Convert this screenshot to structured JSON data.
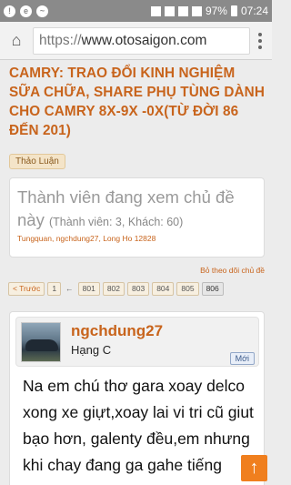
{
  "statusbar": {
    "battery": "97%",
    "time": "07:24"
  },
  "browser": {
    "scheme": "https://",
    "host": "www.otosaigon.com"
  },
  "thread": {
    "title": "CAMRY: TRAO ĐỔI KINH NGHIỆM SỮA CHỮA, SHARE PHỤ TÙNG DÀNH CHO CAMRY 8X-9X -0X(TỪ ĐỜI 86 ĐẾN 201)",
    "tag": "Thảo Luận"
  },
  "viewers": {
    "heading": "Thành viên đang xem chủ đề này",
    "counts": "(Thành viên: 3, Khách: 60)",
    "names": "Tungquan, ngchdung27, Long Ho 12828"
  },
  "watch_label": "Bỏ theo dõi chủ đề",
  "pager": {
    "prev": "< Trước",
    "first": "1",
    "arrow": "←",
    "pages": [
      "801",
      "802",
      "803",
      "804",
      "805"
    ],
    "current": "806"
  },
  "post": {
    "username": "ngchdung27",
    "rank": "Hạng C",
    "badge": "Mới",
    "body": "Na em chú thơ gara xoay delco xong xe giựt,xoay lai vi tri cũ giut bạo hơn, galenty đều,em nhưng khi chay đang ga gahe tiếng"
  },
  "scroll_top_icon": "arrow-up"
}
